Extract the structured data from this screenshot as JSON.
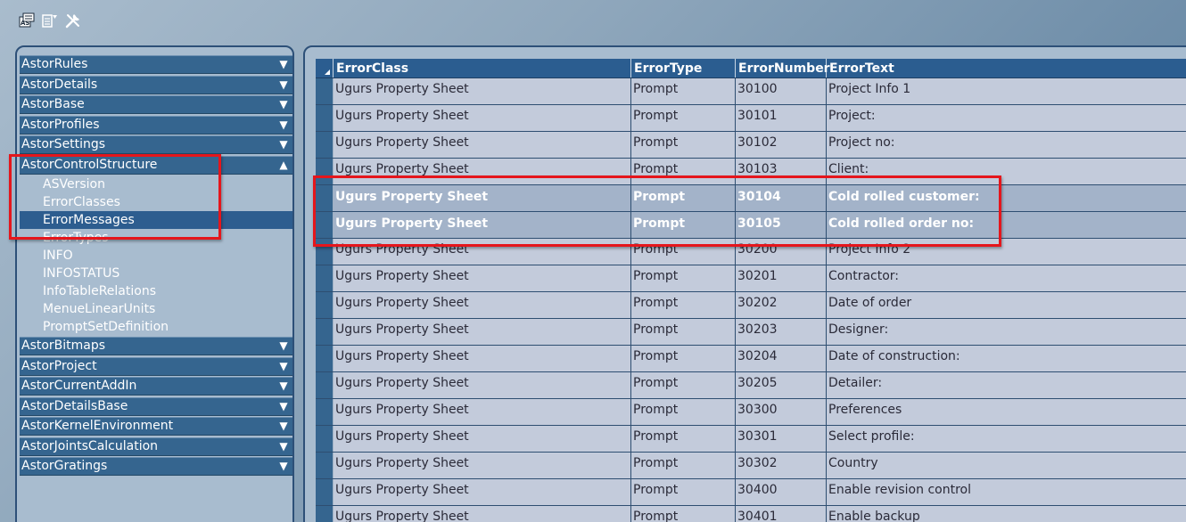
{
  "toolbar": {
    "icons": [
      "as-icon",
      "list-icon",
      "tools-icon"
    ],
    "as_label": "AS"
  },
  "nav": {
    "groups": [
      {
        "label": "AstorRules",
        "expanded": false
      },
      {
        "label": "AstorDetails",
        "expanded": false
      },
      {
        "label": "AstorBase",
        "expanded": false
      },
      {
        "label": "AstorProfiles",
        "expanded": false
      },
      {
        "label": "AstorSettings",
        "expanded": false
      },
      {
        "label": "AstorControlStructure",
        "expanded": true,
        "children": [
          "ASVersion",
          "ErrorClasses",
          "ErrorMessages",
          "ErrorTypes",
          "INFO",
          "INFOSTATUS",
          "InfoTableRelations",
          "MenueLinearUnits",
          "PromptSetDefinition"
        ],
        "selected_child": "ErrorMessages"
      },
      {
        "label": "AstorBitmaps",
        "expanded": false
      },
      {
        "label": "AstorProject",
        "expanded": false
      },
      {
        "label": "AstorCurrentAddIn",
        "expanded": false
      },
      {
        "label": "AstorDetailsBase",
        "expanded": false
      },
      {
        "label": "AstorKernelEnvironment",
        "expanded": false
      },
      {
        "label": "AstorJointsCalculation",
        "expanded": false
      },
      {
        "label": "AstorGratings",
        "expanded": false
      }
    ],
    "arrow_down": "▼",
    "arrow_up": "▲"
  },
  "grid": {
    "columns": [
      "ErrorClass",
      "ErrorType",
      "ErrorNumber",
      "ErrorText"
    ],
    "rows": [
      {
        "cls": "Ugurs Property Sheet",
        "type": "Prompt",
        "num": "30100",
        "text": "Project Info 1"
      },
      {
        "cls": "Ugurs Property Sheet",
        "type": "Prompt",
        "num": "30101",
        "text": "Project:"
      },
      {
        "cls": "Ugurs Property Sheet",
        "type": "Prompt",
        "num": "30102",
        "text": "Project no:"
      },
      {
        "cls": "Ugurs Property Sheet",
        "type": "Prompt",
        "num": "30103",
        "text": "Client:"
      },
      {
        "cls": "Ugurs Property Sheet",
        "type": "Prompt",
        "num": "30104",
        "text": "Cold rolled customer:",
        "selected": true
      },
      {
        "cls": "Ugurs Property Sheet",
        "type": "Prompt",
        "num": "30105",
        "text": "Cold rolled order no:",
        "selected": true
      },
      {
        "cls": "Ugurs Property Sheet",
        "type": "Prompt",
        "num": "30200",
        "text": "Project Info 2"
      },
      {
        "cls": "Ugurs Property Sheet",
        "type": "Prompt",
        "num": "30201",
        "text": "Contractor:"
      },
      {
        "cls": "Ugurs Property Sheet",
        "type": "Prompt",
        "num": "30202",
        "text": "Date of order"
      },
      {
        "cls": "Ugurs Property Sheet",
        "type": "Prompt",
        "num": "30203",
        "text": "Designer:"
      },
      {
        "cls": "Ugurs Property Sheet",
        "type": "Prompt",
        "num": "30204",
        "text": "Date of construction:"
      },
      {
        "cls": "Ugurs Property Sheet",
        "type": "Prompt",
        "num": "30205",
        "text": "Detailer:"
      },
      {
        "cls": "Ugurs Property Sheet",
        "type": "Prompt",
        "num": "30300",
        "text": "Preferences"
      },
      {
        "cls": "Ugurs Property Sheet",
        "type": "Prompt",
        "num": "30301",
        "text": "Select profile:"
      },
      {
        "cls": "Ugurs Property Sheet",
        "type": "Prompt",
        "num": "30302",
        "text": "Country"
      },
      {
        "cls": "Ugurs Property Sheet",
        "type": "Prompt",
        "num": "30400",
        "text": "Enable revision control"
      },
      {
        "cls": "Ugurs Property Sheet",
        "type": "Prompt",
        "num": "30401",
        "text": "Enable backup"
      }
    ]
  },
  "colors": {
    "header_blue": "#35658f",
    "selection_blue": "#2d5d8f",
    "annotation_red": "#e5161c"
  }
}
